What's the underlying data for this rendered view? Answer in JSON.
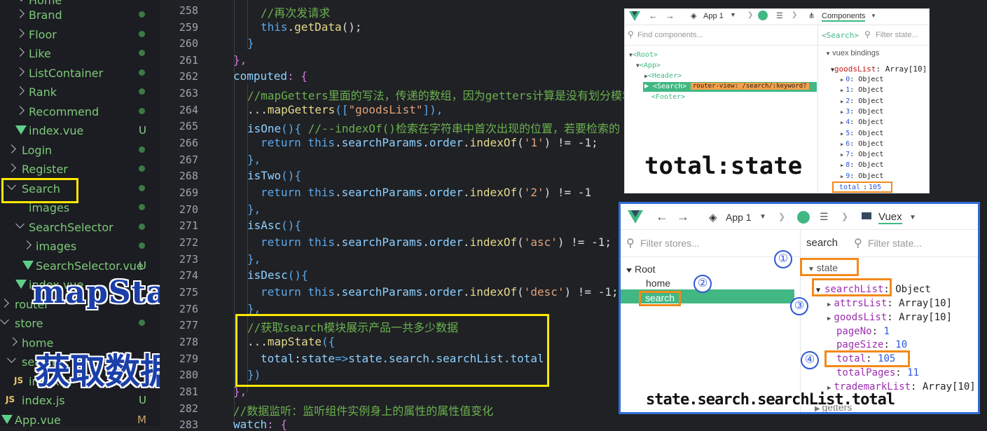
{
  "explorer": {
    "items": [
      {
        "label": "Home"
      },
      {
        "label": "Brand"
      },
      {
        "label": "Floor"
      },
      {
        "label": "Like"
      },
      {
        "label": "ListContainer"
      },
      {
        "label": "Rank"
      },
      {
        "label": "Recommend"
      },
      {
        "label": "index.vue",
        "status": "U"
      },
      {
        "label": "Login"
      },
      {
        "label": "Register"
      },
      {
        "label": "Search"
      },
      {
        "label": "images"
      },
      {
        "label": "SearchSelector"
      },
      {
        "label": "images"
      },
      {
        "label": "SearchSelector.vue",
        "status": "U"
      },
      {
        "label": "index.vue"
      },
      {
        "label": "router"
      },
      {
        "label": "store"
      },
      {
        "label": "home"
      },
      {
        "label": "search"
      },
      {
        "label": "index.js"
      },
      {
        "label": "index.js",
        "status": "U"
      },
      {
        "label": "App.vue",
        "status": "M"
      }
    ]
  },
  "overlay": {
    "map_state": "mapState",
    "get_data": "获取数据",
    "total_state": "total:state",
    "path_caption": "state.search.searchList.total"
  },
  "editor": {
    "line_numbers": [
      "258",
      "259",
      "260",
      "261",
      "262",
      "263",
      "264",
      "265",
      "266",
      "267",
      "268",
      "269",
      "270",
      "271",
      "272",
      "273",
      "274",
      "275",
      "276",
      "277",
      "278",
      "279",
      "280",
      "281",
      "282",
      "283"
    ],
    "lines": {
      "l258": "//再次发请求",
      "l259a": "this",
      "l259b": ".",
      "l259c": "getData",
      "l259d": "();",
      "l260": "}",
      "l261": "},",
      "l262a": "computed",
      "l262b": ": {",
      "l263": "//mapGetters里面的写法，传递的数组，因为getters计算是没有划分模块",
      "l264a": "...",
      "l264b": "mapGetters",
      "l264c": "([",
      "l264d": "\"goodsList\"",
      "l264e": "]),",
      "l265a": "isOne",
      "l265b": "(){",
      "l265c": " //--indexOf()检索在字符串中首次出现的位置，若要检索的",
      "l266a": "return",
      "l266b": " this",
      "l266c": ".",
      "l266d": "searchParams",
      "l266e": ".",
      "l266f": "order",
      "l266g": ".",
      "l266h": "indexOf",
      "l266i": "(",
      "l266j": "'1'",
      "l266k": ") != -1;",
      "l267": "},",
      "l268a": "isTwo",
      "l268b": "(){",
      "l269a": "return",
      "l269b": " this",
      "l269c": ".",
      "l269d": "searchParams",
      "l269e": ".",
      "l269f": "order",
      "l269g": ".",
      "l269h": "indexOf",
      "l269i": "(",
      "l269j": "'2'",
      "l269k": ") != -1",
      "l270": "},",
      "l271a": "isAsc",
      "l271b": "(){",
      "l272a": "return",
      "l272b": " this",
      "l272c": ".",
      "l272d": "searchParams",
      "l272e": ".",
      "l272f": "order",
      "l272g": ".",
      "l272h": "indexOf",
      "l272i": "(",
      "l272j": "'asc'",
      "l272k": ") != -1;",
      "l273": "},",
      "l274a": "isDesc",
      "l274b": "(){",
      "l275a": "return",
      "l275b": " this",
      "l275c": ".",
      "l275d": "searchParams",
      "l275e": ".",
      "l275f": "order",
      "l275g": ".",
      "l275h": "indexOf",
      "l275i": "(",
      "l275j": "'desc'",
      "l275k": ") != -1;",
      "l276": "},",
      "l277": "//获取search模块展示产品一共多少数据",
      "l278a": "...",
      "l278b": "mapState",
      "l278c": "({",
      "l279a": "total",
      "l279b": ":",
      "l279c": "state",
      "l279d": "=>",
      "l279e": "state",
      "l279f": ".search.searchList.total",
      "l280": "})",
      "l281": "},",
      "l282": "//数据监听：监听组件实例身上的属性的属性值变化",
      "l283a": "watch",
      "l283b": ": {"
    }
  },
  "devtools_components": {
    "app": "App 1",
    "mode": "Components",
    "find_placeholder": "Find components...",
    "selected": "<Search>",
    "filter_placeholder": "Filter state...",
    "tree": [
      "<Root>",
      "<App>",
      "<Header>",
      "<Search>",
      "<Footer>"
    ],
    "route_badge": "router-view: /search/:keyword?",
    "bindings_title": "vuex bindings",
    "goods_key": "goodsList",
    "goods_type": "Array[10]",
    "goods_items": [
      {
        "key": "0",
        "type": "Object"
      },
      {
        "key": "1",
        "type": "Object"
      },
      {
        "key": "2",
        "type": "Object"
      },
      {
        "key": "3",
        "type": "Object"
      },
      {
        "key": "4",
        "type": "Object"
      },
      {
        "key": "5",
        "type": "Object"
      },
      {
        "key": "6",
        "type": "Object"
      },
      {
        "key": "7",
        "type": "Object"
      },
      {
        "key": "8",
        "type": "Object"
      },
      {
        "key": "9",
        "type": "Object"
      }
    ],
    "total_key": "total",
    "total_value": "105"
  },
  "devtools_vuex": {
    "app": "App 1",
    "mode": "Vuex",
    "filter_stores_placeholder": "Filter stores...",
    "selected_store": "search",
    "filter_state_placeholder": "Filter state...",
    "stores": [
      "Root",
      "home",
      "search"
    ],
    "state_label": "state",
    "searchList_key": "searchList",
    "searchList_type": "Object",
    "fields": [
      {
        "key": "attrsList",
        "value": "Array[10]",
        "expandable": true
      },
      {
        "key": "goodsList",
        "value": "Array[10]",
        "expandable": true
      },
      {
        "key": "pageNo",
        "value": "1",
        "expandable": false
      },
      {
        "key": "pageSize",
        "value": "10",
        "expandable": false
      },
      {
        "key": "total",
        "value": "105",
        "expandable": false
      },
      {
        "key": "totalPages",
        "value": "11",
        "expandable": false
      },
      {
        "key": "trademarkList",
        "value": "Array[10]",
        "expandable": true
      }
    ],
    "getters_label": "getters",
    "markers": [
      "①",
      "②",
      "③",
      "④"
    ]
  }
}
